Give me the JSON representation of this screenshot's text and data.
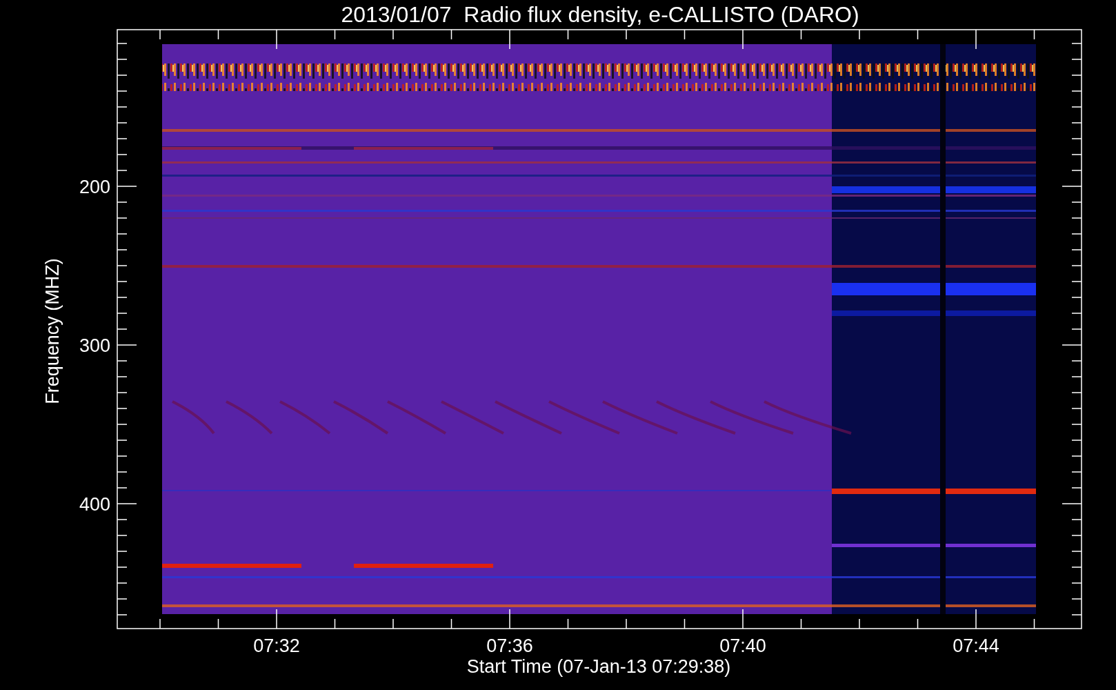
{
  "title": "2013/01/07  Radio flux density, e-CALLISTO (DARO)",
  "y_axis": {
    "label": "Frequency (MHZ)",
    "tick_labels": [
      "200",
      "300",
      "400"
    ]
  },
  "x_axis": {
    "label": "Start Time (07-Jan-13 07:29:38)",
    "tick_labels": [
      "07:32",
      "07:36",
      "07:40",
      "07:44"
    ]
  }
}
